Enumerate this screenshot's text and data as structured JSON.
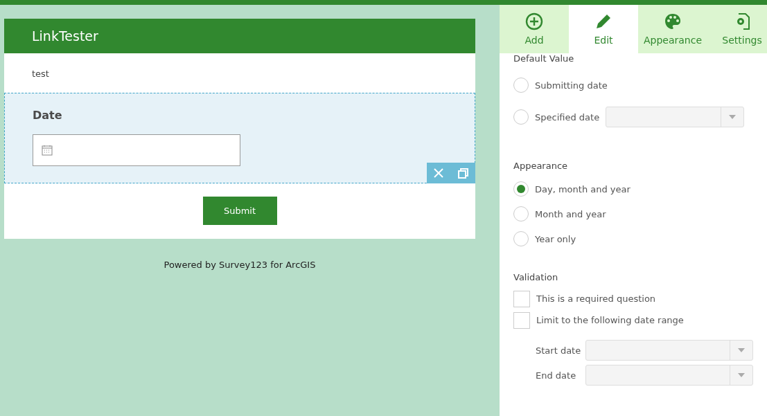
{
  "form": {
    "title": "LinkTester",
    "description": "test",
    "question": {
      "label": "Date"
    },
    "submit": "Submit",
    "footer": "Powered by Survey123 for ArcGIS"
  },
  "tabs": [
    {
      "label": "Add",
      "kind": "add",
      "selected": false
    },
    {
      "label": "Edit",
      "kind": "edit",
      "selected": true
    },
    {
      "label": "Appearance",
      "kind": "palette",
      "selected": false
    },
    {
      "label": "Settings",
      "kind": "settings",
      "selected": false
    }
  ],
  "default_value": {
    "heading": "Default Value",
    "options": [
      {
        "label": "Submitting date",
        "selected": false,
        "kind": "plain"
      },
      {
        "label": "Specified date",
        "selected": false,
        "kind": "select"
      }
    ]
  },
  "appearance": {
    "heading": "Appearance",
    "options": [
      {
        "label": "Day, month and year",
        "selected": true
      },
      {
        "label": "Month and year",
        "selected": false
      },
      {
        "label": "Year only",
        "selected": false
      }
    ]
  },
  "validation": {
    "heading": "Validation",
    "checks": [
      {
        "label": "This is a required question",
        "checked": false
      },
      {
        "label": "Limit to the following date range",
        "checked": false
      }
    ],
    "ranges": [
      {
        "label": "Start date"
      },
      {
        "label": "End date"
      }
    ]
  }
}
